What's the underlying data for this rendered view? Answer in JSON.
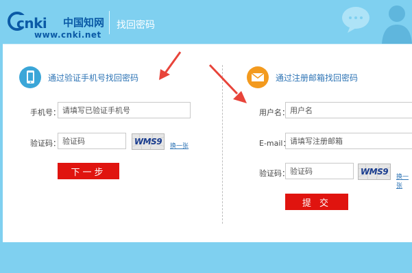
{
  "header": {
    "logo_latin": "cnki",
    "logo_cn": "中国知网",
    "logo_url": "www.cnki.net",
    "page_title": "找回密码"
  },
  "phone_section": {
    "title": "通过验证手机号找回密码",
    "phone_label": "手机号：",
    "phone_placeholder": "请填写已验证手机号",
    "code_label": "验证码：",
    "code_value": "验证码",
    "captcha_text": "WMS9",
    "refresh_label": "换一张",
    "next_button": "下一步"
  },
  "email_section": {
    "title": "通过注册邮箱找回密码",
    "username_label": "用户名：",
    "username_value": "用户名",
    "email_label": "E-mail：",
    "email_placeholder": "请填写注册邮箱",
    "code_label": "验证码：",
    "code_value": "验证码",
    "captcha_text": "WMS9",
    "refresh_label": "换一张",
    "submit_button": "提 交"
  },
  "colors": {
    "sky": "#7fd0f0",
    "accent_blue": "#2e74b5",
    "button_red": "#e0140f",
    "phone_icon_bg": "#3ba6d8",
    "mail_icon_bg": "#f39a1e",
    "arrow_red": "#e8443a"
  },
  "icons": {
    "phone": "phone-icon",
    "mail": "envelope-icon",
    "chat": "chat-bubble-icon",
    "user": "user-silhouette-icon"
  }
}
